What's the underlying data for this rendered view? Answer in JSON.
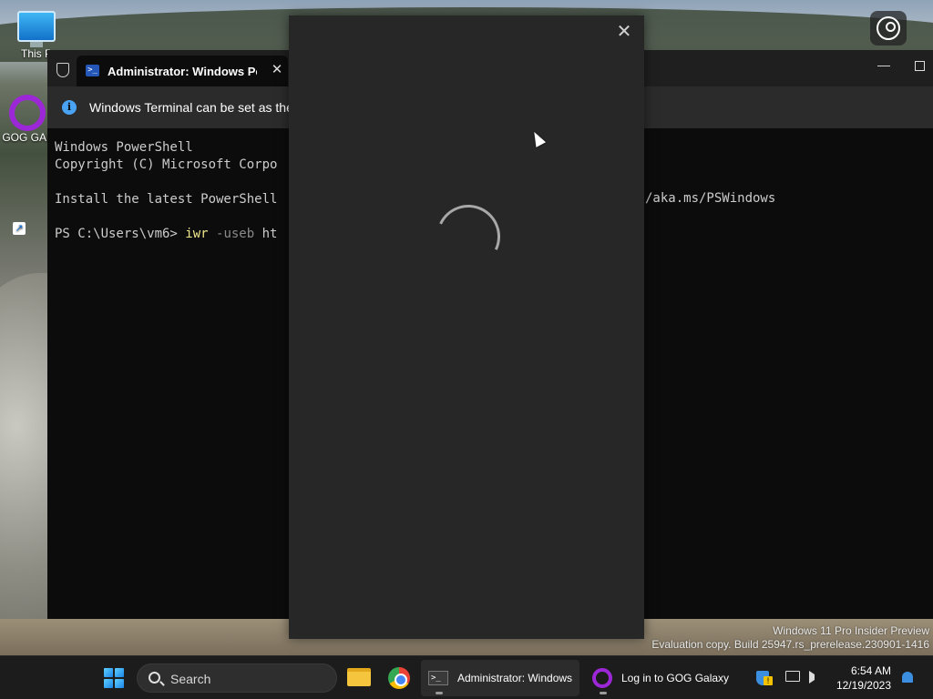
{
  "desktop": {
    "icons": [
      {
        "label": "This P",
        "icon": "monitor-icon"
      },
      {
        "label": "GOG GAL",
        "icon": "gog-galaxy-icon"
      }
    ],
    "shortcut_arrow": "↗",
    "watermark": {
      "line1": "Windows 11 Pro Insider Preview",
      "line2": "Evaluation copy. Build 25947.rs_prerelease.230901-1416"
    }
  },
  "terminal": {
    "tab_title": "Administrator: Windows Powe",
    "tab_icon_glyph": ">_",
    "close_glyph": "✕",
    "minimize_glyph": "—",
    "info_icon_glyph": "i",
    "info_message": "Windows Terminal can be set as the",
    "lines": {
      "line1": "Windows PowerShell",
      "line2": "Copyright (C) Microsoft Corpo",
      "line3": "Install the latest PowerShell",
      "prompt": "PS C:\\Users\\vm6> ",
      "command": "iwr",
      "param": " -useb",
      "rest": " ht"
    },
    "url_fragment": "/aka.ms/PSWindows"
  },
  "dialog": {
    "close_glyph": "✕",
    "state": "loading"
  },
  "taskbar": {
    "search_label": "Search",
    "apps": [
      {
        "label": "Administrator: Windows",
        "icon": "terminal-icon"
      },
      {
        "label": "Log in to GOG Galaxy",
        "icon": "gog-galaxy-icon"
      }
    ],
    "clock": {
      "time": "6:54 AM",
      "date": "12/19/2023"
    }
  },
  "colors": {
    "terminal_bg": "#0c0c0c",
    "dialog_bg": "#272727",
    "taskbar_bg": "#1c1c1c",
    "accent": "#4aa3f2",
    "gog_purple": "#9c27d6",
    "command_yellow": "#f0e68c"
  }
}
